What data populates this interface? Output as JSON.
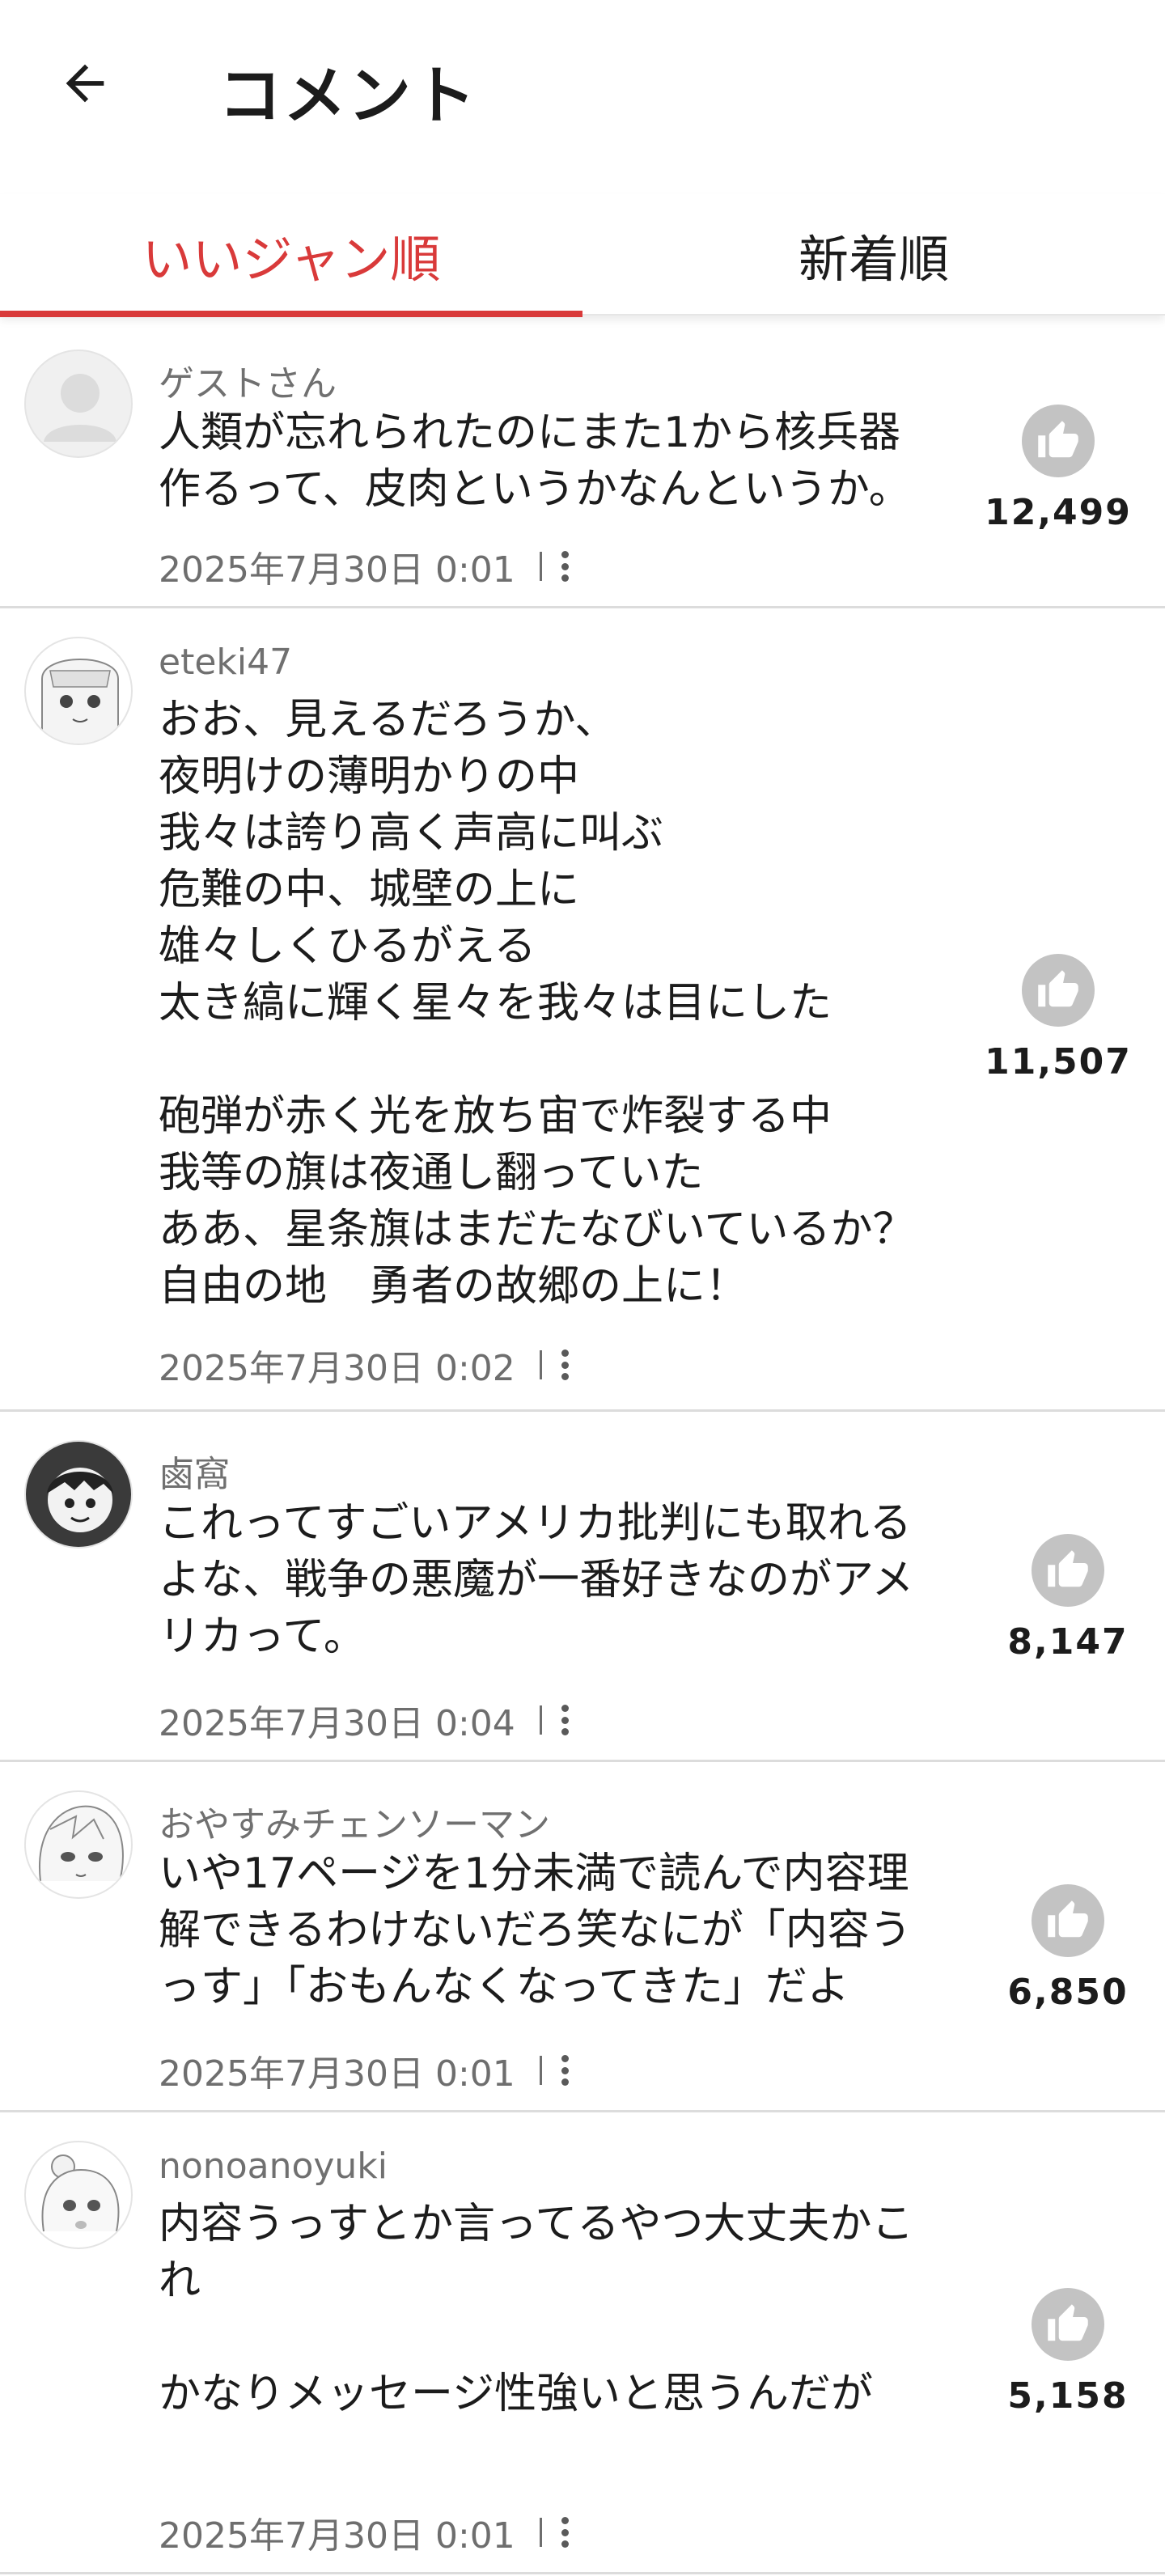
{
  "header": {
    "title": "コメント"
  },
  "tabs": {
    "popular": "いいジャン順",
    "newest": "新着順"
  },
  "comments": [
    {
      "user": "ゲストさん",
      "text": "人類が忘れられたのにまた1から核兵器\n作るって、皮肉というかなんというか。",
      "date": "2025年7月30日 0:01",
      "likes": "12,499"
    },
    {
      "user": "eteki47",
      "text": "おお、見えるだろうか、\n夜明けの薄明かりの中\n我々は誇り高く声高に叫ぶ\n危難の中、城壁の上に\n雄々しくひるがえる\n太き縞に輝く星々を我々は目にした\n\n砲弾が赤く光を放ち宙で炸裂する中\n我等の旗は夜通し翻っていた\nああ、星条旗はまだたなびいているか？\n自由の地　勇者の故郷の上に！",
      "date": "2025年7月30日 0:02",
      "likes": "11,507"
    },
    {
      "user": "鹵窩",
      "text": "これってすごいアメリカ批判にも取れる\nよな、戦争の悪魔が一番好きなのがアメ\nリカって。",
      "date": "2025年7月30日 0:04",
      "likes": "8,147"
    },
    {
      "user": "おやすみチェンソーマン",
      "text": "いや17ページを1分未満で読んで内容理\n解できるわけないだろ笑なにが「内容う\nっす」「おもんなくなってきた」だよ",
      "date": "2025年7月30日 0:01",
      "likes": "6,850"
    },
    {
      "user": "nonoanoyuki",
      "text": "内容うっすとか言ってるやつ大丈夫かこ\nれ\n\nかなりメッセージ性強いと思うんだが",
      "date": "2025年7月30日 0:01",
      "likes": "5,158"
    }
  ],
  "icons": {
    "back": "arrow-left-icon",
    "like": "thumbs-up-icon",
    "more": "more-vertical-icon"
  },
  "colors": {
    "accent": "#d93a3a",
    "like_bg": "#c3c3c3"
  }
}
